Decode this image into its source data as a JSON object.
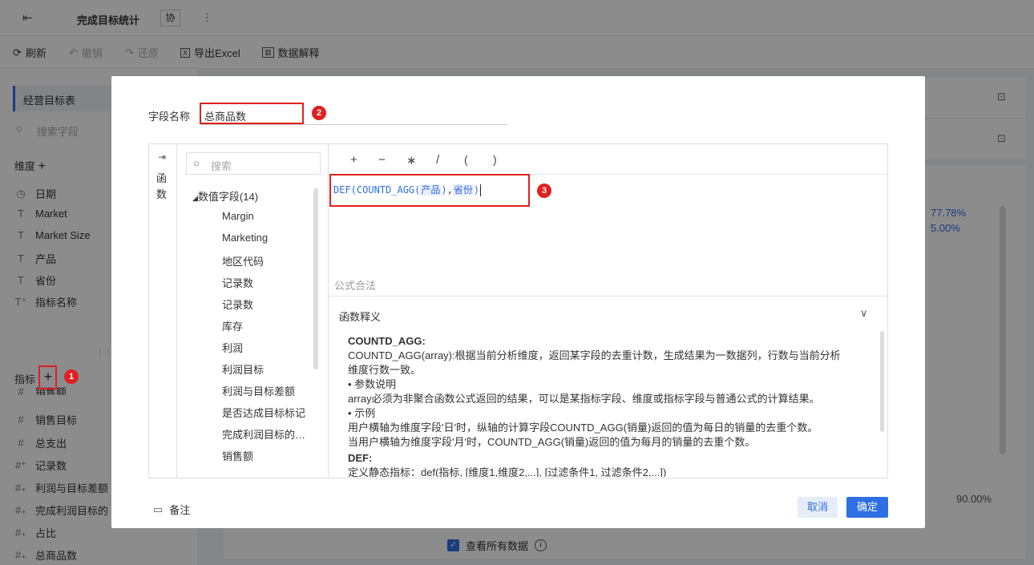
{
  "app": {
    "title": "完成目标统计",
    "collab_badge": "协",
    "more": "⋮"
  },
  "toolbar": {
    "refresh": "刷新",
    "undo": "撤销",
    "redo": "还原",
    "export": "导出Excel",
    "explain": "数据解释"
  },
  "left": {
    "table_name": "经营目标表",
    "search_placeholder": "搜索字段",
    "dimension_header": "维度",
    "dimensions": [
      "日期",
      "Market",
      "Market Size",
      "产品",
      "省份",
      "指标名称"
    ],
    "metrics_header": "指标",
    "metrics": [
      "销售额",
      "销售目标",
      "总支出",
      "记录数",
      "利润与目标差额",
      "完成利润目标的",
      "占比",
      "总商品数"
    ]
  },
  "bg": {
    "pct1": "77.78%",
    "pct2": "5.00%",
    "pct3": "90.00%",
    "view_all": "查看所有数据"
  },
  "dialog": {
    "field_label": "字段名称",
    "field_value": "总商品数",
    "side_tab": "函数",
    "search_placeholder": "搜索",
    "group_label": "数值字段(14)",
    "fields": [
      "Margin",
      "Marketing",
      "地区代码",
      "记录数",
      "记录数",
      "库存",
      "利润",
      "利润目标",
      "利润与目标差额",
      "是否达成目标标记",
      "完成利润目标的…",
      "销售额"
    ],
    "operators": [
      "+",
      "−",
      "∗",
      "/",
      "(",
      ")"
    ],
    "formula": {
      "fn": "DEF(",
      "inner": "COUNTD_AGG(",
      "arg1": "产品",
      "close1": ")",
      "comma": ",",
      "arg2": "省份",
      "close2": ")"
    },
    "status": "公式合法",
    "help_header": "函数释义",
    "help": [
      {
        "type": "title",
        "text": "COUNTD_AGG:"
      },
      {
        "type": "text",
        "text": "COUNTD_AGG(array):根据当前分析维度，返回某字段的去重计数，生成结果为一数据列，行数与当前分析"
      },
      {
        "type": "text",
        "text": "维度行数一致。"
      },
      {
        "type": "text",
        "text": "• 参数说明"
      },
      {
        "type": "text",
        "text": "array必须为非聚合函数公式返回的结果，可以是某指标字段、维度或指标字段与普通公式的计算结果。"
      },
      {
        "type": "text",
        "text": "• 示例"
      },
      {
        "type": "text",
        "text": "用户横轴为维度字段'日'时，纵轴的计算字段COUNTD_AGG(销量)返回的值为每日的销量的去重个数。"
      },
      {
        "type": "text",
        "text": "当用户横轴为维度字段'月'时，COUNTD_AGG(销量)返回的值为每月的销量的去重个数。"
      },
      {
        "type": "title",
        "text": "DEF:"
      },
      {
        "type": "text",
        "text": "定义静态指标：def(指标, [维度1,维度2,...], [过滤条件1, 过滤条件2,...])"
      }
    ],
    "remark": "备注",
    "cancel": "取消",
    "confirm": "确定"
  },
  "annotations": [
    "1",
    "2",
    "3"
  ],
  "colors": {
    "accent": "#2f6fe4",
    "annot": "#e02020",
    "mask": "rgba(0,0,0,0.45)"
  }
}
